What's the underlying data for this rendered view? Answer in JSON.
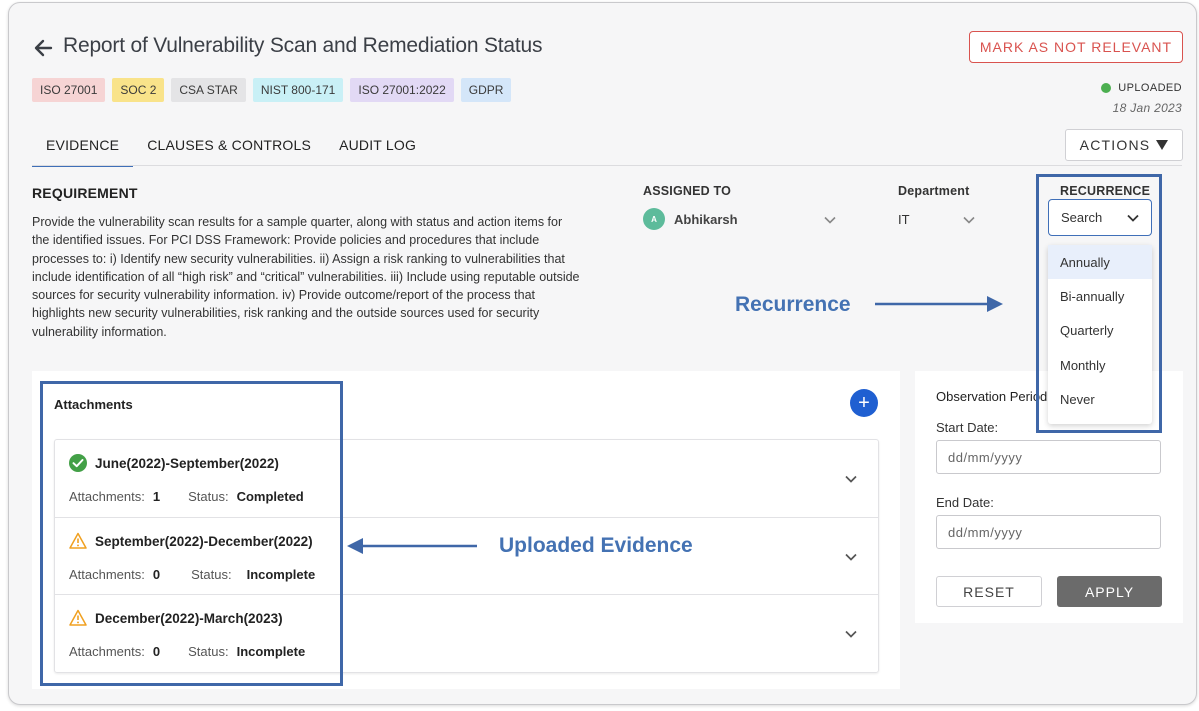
{
  "header": {
    "title": "Report of Vulnerability Scan and Remediation Status",
    "mark_button": "MARK AS NOT RELEVANT",
    "status": "UPLOADED",
    "status_date": "18 Jan 2023",
    "tags": [
      {
        "label": "ISO 27001",
        "color": "#f6d4d4"
      },
      {
        "label": "SOC 2",
        "color": "#f9e38a"
      },
      {
        "label": "CSA STAR",
        "color": "#e4e4e6"
      },
      {
        "label": "NIST 800-171",
        "color": "#c9f0f6"
      },
      {
        "label": "ISO 27001:2022",
        "color": "#e2d9f5"
      },
      {
        "label": "GDPR",
        "color": "#d4e6f9"
      }
    ]
  },
  "tabs": [
    "EVIDENCE",
    "CLAUSES & CONTROLS",
    "AUDIT LOG"
  ],
  "actions_button": "ACTIONS",
  "requirement": {
    "title": "REQUIREMENT",
    "text": "Provide the vulnerability scan results for a sample quarter, along with status and action items for the identified issues. For PCI DSS Framework: Provide policies and procedures that include processes to: i) Identify new security vulnerabilities. ii) Assign a risk ranking to vulnerabilities that include identification of all “high risk” and “critical” vulnerabilities. iii) Include using reputable outside sources for security vulnerability information. iv) Provide outcome/report of the process that highlights new security vulnerabilities, risk ranking and the outside sources used for security vulnerability information."
  },
  "assigned_to": {
    "label": "ASSIGNED TO",
    "initial": "A",
    "name": "Abhikarsh"
  },
  "department": {
    "label": "Department",
    "value": "IT"
  },
  "recurrence": {
    "label": "RECURRENCE",
    "placeholder": "Search",
    "options": [
      "Annually",
      "Bi-annually",
      "Quarterly",
      "Monthly",
      "Never"
    ],
    "highlighted": "Annually"
  },
  "annotations": {
    "recurrence": "Recurrence",
    "uploaded": "Uploaded Evidence",
    "color": "#3f67a8"
  },
  "attachments": {
    "title": "Attachments",
    "add_symbol": "+",
    "rows": [
      {
        "period": "June(2022)-September(2022)",
        "att_label": "Attachments:",
        "count": "1",
        "status_label": "Status:",
        "status": "Completed",
        "icon": "check-circle-icon"
      },
      {
        "period": "September(2022)-December(2022)",
        "att_label": "Attachments:",
        "count": "0",
        "status_label": "Status:",
        "status": "Incomplete",
        "icon": "warning-icon"
      },
      {
        "period": "December(2022)-March(2023)",
        "att_label": "Attachments:",
        "count": "0",
        "status_label": "Status:",
        "status": "Incomplete",
        "icon": "warning-icon"
      }
    ]
  },
  "observation": {
    "title": "Observation Period",
    "start_label": "Start Date:",
    "start_placeholder": "dd/mm/yyyy",
    "end_label": "End Date:",
    "end_placeholder": "dd/mm/yyyy",
    "reset": "RESET",
    "apply": "APPLY"
  }
}
